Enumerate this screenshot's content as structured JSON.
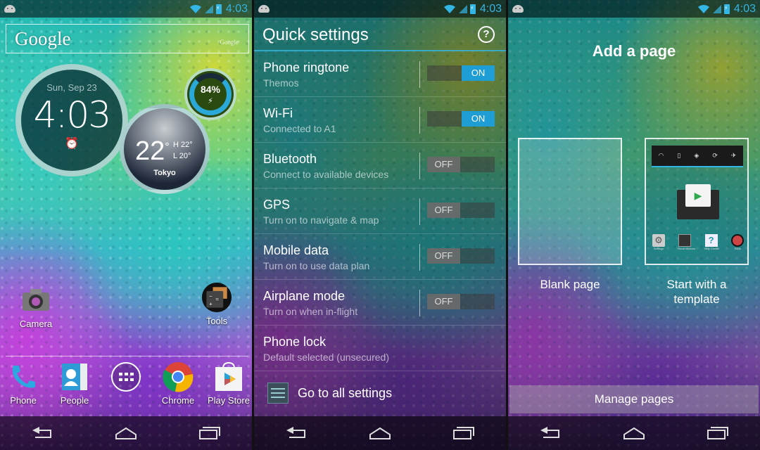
{
  "status_bar": {
    "time": "4:03",
    "icons": [
      "android-notification-icon",
      "wifi-icon",
      "signal-icon",
      "battery-charging-icon"
    ]
  },
  "nav_bar": {
    "buttons": [
      "back",
      "home",
      "recents"
    ]
  },
  "home_screen": {
    "search_widget": {
      "logo": "Google",
      "small_label": "Google"
    },
    "clock_widget": {
      "date": "Sun, Sep 23",
      "time": "4:03",
      "alarm_icon": "alarm-clock-icon"
    },
    "weather_widget": {
      "temp": "22",
      "deg": "°",
      "high": "H 22°",
      "low": "L 20°",
      "city": "Tokyo"
    },
    "battery_widget": {
      "percent": "84%",
      "level": 0.84,
      "charging": true
    },
    "apps": [
      {
        "label": "Camera",
        "icon": "camera-icon"
      },
      {
        "label": "Tools",
        "icon": "tools-folder-icon"
      }
    ],
    "dock": [
      {
        "label": "Phone",
        "icon": "phone-icon"
      },
      {
        "label": "People",
        "icon": "contacts-icon"
      },
      {
        "label": "",
        "icon": "app-drawer-icon"
      },
      {
        "label": "Chrome",
        "icon": "chrome-icon"
      },
      {
        "label": "Play Store",
        "icon": "play-store-icon"
      }
    ]
  },
  "quick_settings": {
    "title": "Quick settings",
    "help_label": "?",
    "rows": [
      {
        "label": "Phone ringtone",
        "sub": "Themos",
        "state": "ON",
        "on": true
      },
      {
        "label": "Wi-Fi",
        "sub": "Connected to A1",
        "state": "ON",
        "on": true
      },
      {
        "label": "Bluetooth",
        "sub": "Connect to available devices",
        "state": "OFF",
        "on": false
      },
      {
        "label": "GPS",
        "sub": "Turn on to navigate & map",
        "state": "OFF",
        "on": false
      },
      {
        "label": "Mobile data",
        "sub": "Turn on to use data plan",
        "state": "OFF",
        "on": false
      },
      {
        "label": "Airplane mode",
        "sub": "Turn on when in-flight",
        "state": "OFF",
        "on": false
      },
      {
        "label": "Phone lock",
        "sub": "Default selected (unsecured)"
      }
    ],
    "all_settings_label": "Go to all settings"
  },
  "add_page": {
    "title": "Add a page",
    "blank_label": "Blank page",
    "template_label_1": "Start with a",
    "template_label_2": "template",
    "template_preview": {
      "toolbar_icons": [
        "wifi-icon",
        "battery-icon",
        "gps-icon",
        "sync-icon",
        "airplane-icon"
      ],
      "apps": [
        {
          "label": "Settings"
        },
        {
          "label": "Smart Actions"
        },
        {
          "label": "Help Center"
        },
        {
          "label": "Tools"
        }
      ]
    },
    "manage_label": "Manage pages"
  },
  "colors": {
    "accent": "#33b5e5",
    "toggle_on": "#1e9ed5"
  }
}
